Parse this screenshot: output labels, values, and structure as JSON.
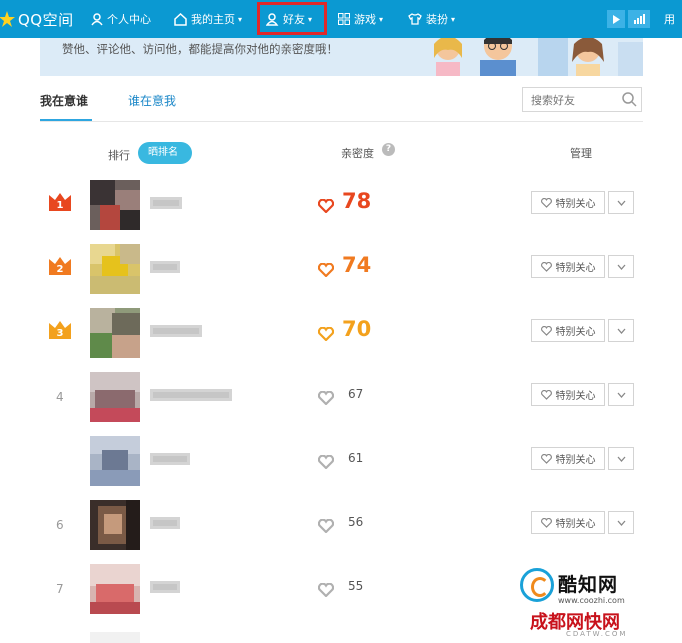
{
  "nav": {
    "brand": "QQ空间",
    "items": [
      {
        "label": "个人中心"
      },
      {
        "label": "我的主页"
      },
      {
        "label": "好友"
      },
      {
        "label": "游戏"
      },
      {
        "label": "装扮"
      }
    ],
    "right_text": "用"
  },
  "banner": {
    "text": "赞他、评论他、访问他，都能提高你对他的亲密度哦！"
  },
  "tabs": [
    {
      "label": "我在意谁",
      "active": true
    },
    {
      "label": "谁在意我",
      "active": false
    }
  ],
  "search": {
    "placeholder": "搜索好友"
  },
  "table_header": {
    "rank": "排行",
    "toggle": "晒排名",
    "intimacy": "亲密度",
    "help": "?",
    "manage": "管理"
  },
  "rows": [
    {
      "rank": "1",
      "score": "78",
      "care": "特别关心"
    },
    {
      "rank": "2",
      "score": "74",
      "care": "特别关心"
    },
    {
      "rank": "3",
      "score": "70",
      "care": "特别关心"
    },
    {
      "rank": "4",
      "score": "67",
      "care": "特别关心"
    },
    {
      "rank": "",
      "score": "61",
      "care": "特别关心"
    },
    {
      "rank": "6",
      "score": "56",
      "care": "特别关心"
    },
    {
      "rank": "7",
      "score": "55",
      "care": ""
    }
  ],
  "colors": {
    "nav_bg": "#0b99d2",
    "highlight_border": "#e0282a",
    "rank1": "#e8471f",
    "rank2": "#f07a20",
    "rank3": "#f3a11d",
    "heart_gray": "#b0b0b0"
  },
  "watermark": {
    "title": "酷知网",
    "url": "www.coozhi.com",
    "brand": "成都网快网",
    "brand_url": "CDATW.COM"
  }
}
